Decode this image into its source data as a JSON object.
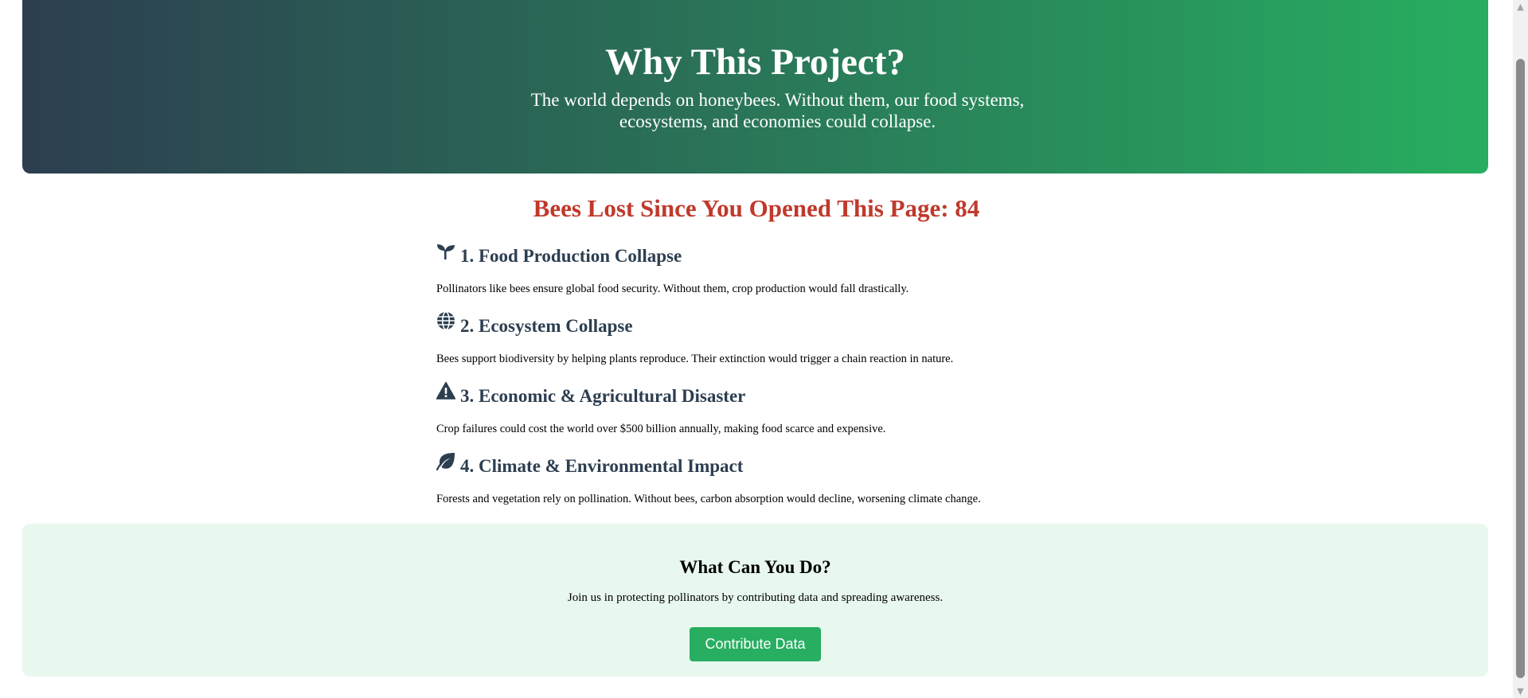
{
  "hero": {
    "title": "Why This Project?",
    "subtitle": "The world depends on honeybees. Without them, our food systems, ecosystems, and economies could collapse."
  },
  "counter": {
    "label": "Bees Lost Since You Opened This Page: 84"
  },
  "reasons": [
    {
      "icon": "seedling-icon",
      "title": "1. Food Production Collapse",
      "text": "Pollinators like bees ensure global food security. Without them, crop production would fall drastically."
    },
    {
      "icon": "globe-icon",
      "title": "2. Ecosystem Collapse",
      "text": "Bees support biodiversity by helping plants reproduce. Their extinction would trigger a chain reaction in nature."
    },
    {
      "icon": "warning-icon",
      "title": "3. Economic & Agricultural Disaster",
      "text": "Crop failures could cost the world over $500 billion annually, making food scarce and expensive."
    },
    {
      "icon": "leaf-icon",
      "title": "4. Climate & Environmental Impact",
      "text": "Forests and vegetation rely on pollination. Without bees, carbon absorption would decline, worsening climate change."
    }
  ],
  "cta": {
    "title": "What Can You Do?",
    "text": "Join us in protecting pollinators by contributing data and spreading awareness.",
    "button_label": "Contribute Data"
  },
  "colors": {
    "hero_gradient_start": "#2c3e50",
    "hero_gradient_end": "#27ae60",
    "counter_red": "#c0392b",
    "heading_navy": "#2c3e50",
    "cta_background": "#e8f8ef",
    "button_green": "#27ae60"
  }
}
